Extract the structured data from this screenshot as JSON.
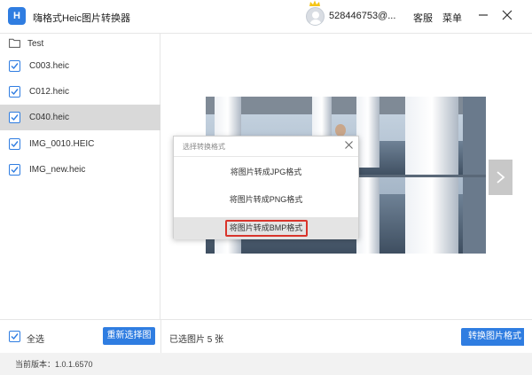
{
  "app": {
    "title": "嗨格式Heic图片转换器",
    "logo_text": "H"
  },
  "header": {
    "user_id": "528446753@...",
    "service_label": "客服",
    "menu_label": "菜单"
  },
  "colors": {
    "accent": "#2f7de1",
    "highlight": "#d9342b",
    "crown": "#f5c518"
  },
  "sidebar": {
    "folder": "Test",
    "files": [
      {
        "name": "C003.heic",
        "checked": true,
        "selected": false
      },
      {
        "name": "C012.heic",
        "checked": true,
        "selected": false
      },
      {
        "name": "C040.heic",
        "checked": true,
        "selected": true
      },
      {
        "name": "IMG_0010.HEIC",
        "checked": true,
        "selected": false
      },
      {
        "name": "IMG_new.heic",
        "checked": true,
        "selected": false
      }
    ]
  },
  "dialog": {
    "title": "选择转换格式",
    "options": [
      {
        "label": "将图片转成JPG格式"
      },
      {
        "label": "将图片转成PNG格式"
      },
      {
        "label": "将图片转成BMP格式",
        "highlighted": true
      }
    ]
  },
  "bottom": {
    "select_all_label": "全选",
    "reselect_label": "重新选择图片",
    "selected_count": "已选图片 5 张",
    "convert_label": "转换图片格式"
  },
  "status": {
    "version": "当前版本：1.0.1.6570"
  }
}
